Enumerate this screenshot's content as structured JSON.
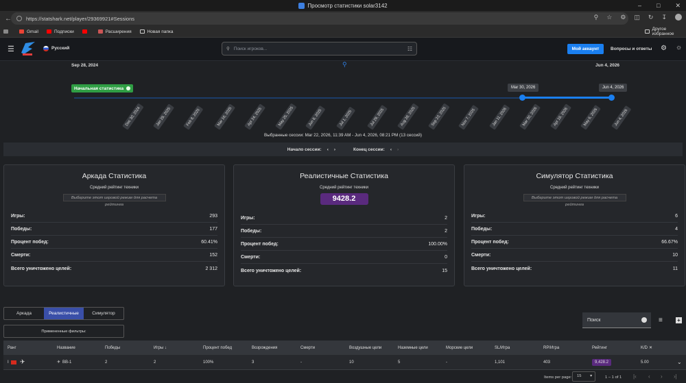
{
  "browser": {
    "title": "Просмотр статистики solar3142",
    "url": "https://statshark.net/player/29369921#Sessions",
    "bookmarks": [
      "Gmail",
      "Подписки",
      "Расширения",
      "Новая папка"
    ],
    "other_bookmarks": "Другое избранное"
  },
  "header": {
    "language": "Русский",
    "search_placeholder": "Поиск игроков...",
    "account_button": "Мой аккаунт",
    "faq_link": "Вопросы и ответы"
  },
  "timeline": {
    "start_date": "Sep 28, 2024",
    "end_date": "Jun 4, 2026",
    "initial_stats_label": "Начальная статистика",
    "range_start_tip": "Mar 30, 2026",
    "range_end_tip": "Jun 4, 2026",
    "ticks": [
      "Dec 30, 2024",
      "Jan 28, 2025",
      "Feb 8, 2025",
      "Mar 16, 2025",
      "Apr 24, 2025",
      "May 25, 2025",
      "Jun 8, 2025",
      "Jul 1, 2025",
      "Jul 29, 2025",
      "Aug 28, 2025",
      "Sep 23, 2025",
      "Nov 7, 2025",
      "Jan 11, 2026",
      "Mar 30, 2026",
      "Apr 18, 2026",
      "May 6, 2026",
      "Jun 4, 2026"
    ],
    "selected_sessions": "Выбранные сессии: Mar 22, 2026, 11:39 AM - Jun 4, 2026, 08:21 PM (13 сессий)",
    "session_start_label": "Начало сессии:",
    "session_end_label": "Конец сессии:"
  },
  "cards": [
    {
      "title": "Аркада Статистика",
      "rating_label": "Средний рейтинг техники",
      "rating_hint": "Выберите этот игровой режим для расчета рейтинга",
      "rows": [
        [
          "Игры:",
          "293"
        ],
        [
          "Победы:",
          "177"
        ],
        [
          "Процент побед:",
          "60.41%"
        ],
        [
          "Смерти:",
          "152"
        ],
        [
          "Всего уничтожено целей:",
          "2 312"
        ]
      ]
    },
    {
      "title": "Реалистичные Статистика",
      "rating_label": "Средний рейтинг техники",
      "rating_value": "9428.2",
      "rows": [
        [
          "Игры:",
          "2"
        ],
        [
          "Победы:",
          "2"
        ],
        [
          "Процент побед:",
          "100.00%"
        ],
        [
          "Смерти:",
          "0"
        ],
        [
          "Всего уничтожено целей:",
          "15"
        ]
      ]
    },
    {
      "title": "Симулятор Статистика",
      "rating_label": "Средний рейтинг техники",
      "rating_hint": "Выберите этот игровой режим для расчета рейтинга",
      "rows": [
        [
          "Игры:",
          "6"
        ],
        [
          "Победы:",
          "4"
        ],
        [
          "Процент побед:",
          "66.67%"
        ],
        [
          "Смерти:",
          "10"
        ],
        [
          "Всего уничтожено целей:",
          "11"
        ]
      ]
    }
  ],
  "tabs": [
    "Аркада",
    "Реалистичные",
    "Симулятор"
  ],
  "filters_label": "Примененные фильтры:",
  "table_search": "Поиск",
  "table": {
    "headers": [
      "Ранг",
      "Название",
      "Победы",
      "Игры ↓",
      "Процент побед",
      "Возрождения",
      "Смерти",
      "Воздушные цели",
      "Наземные цели",
      "Морские цели",
      "SL/Игра",
      "RP/Игра",
      "Рейтинг",
      "K/D"
    ],
    "row": [
      "I",
      "BB-1",
      "2",
      "2",
      "100%",
      "3",
      "-",
      "10",
      "5",
      "-",
      "1,101",
      "403",
      "9,428.2",
      "5.00"
    ]
  },
  "pager": {
    "items_label": "Items per page:",
    "per_page": "15",
    "range": "1 – 1 of 1"
  }
}
